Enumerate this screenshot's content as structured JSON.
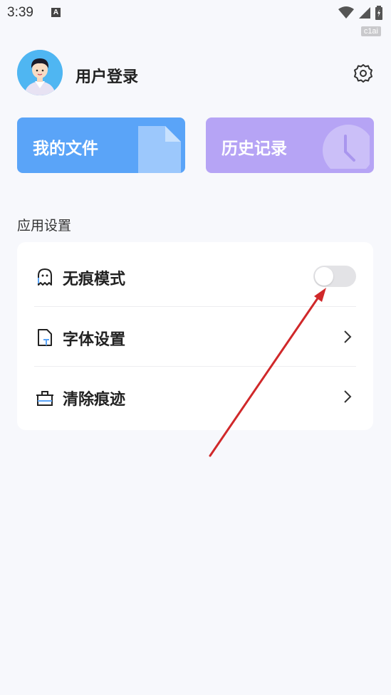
{
  "status_bar": {
    "time": "3:39",
    "notification_icon_letter": "A",
    "watermark": "c1ai"
  },
  "header": {
    "login_label": "用户登录"
  },
  "cards": {
    "files_label": "我的文件",
    "history_label": "历史记录"
  },
  "section": {
    "title": "应用设置"
  },
  "settings": [
    {
      "label": "无痕模式",
      "icon": "ghost-icon",
      "control": "toggle",
      "enabled": false
    },
    {
      "label": "字体设置",
      "icon": "font-file-icon",
      "control": "chevron"
    },
    {
      "label": "清除痕迹",
      "icon": "clear-box-icon",
      "control": "chevron"
    }
  ],
  "colors": {
    "background": "#f7f8fc",
    "files_card": "#5aa4f8",
    "history_card": "#b6a4f5",
    "toggle_off": "#e3e3e6",
    "annotation_arrow": "#d0282a"
  }
}
